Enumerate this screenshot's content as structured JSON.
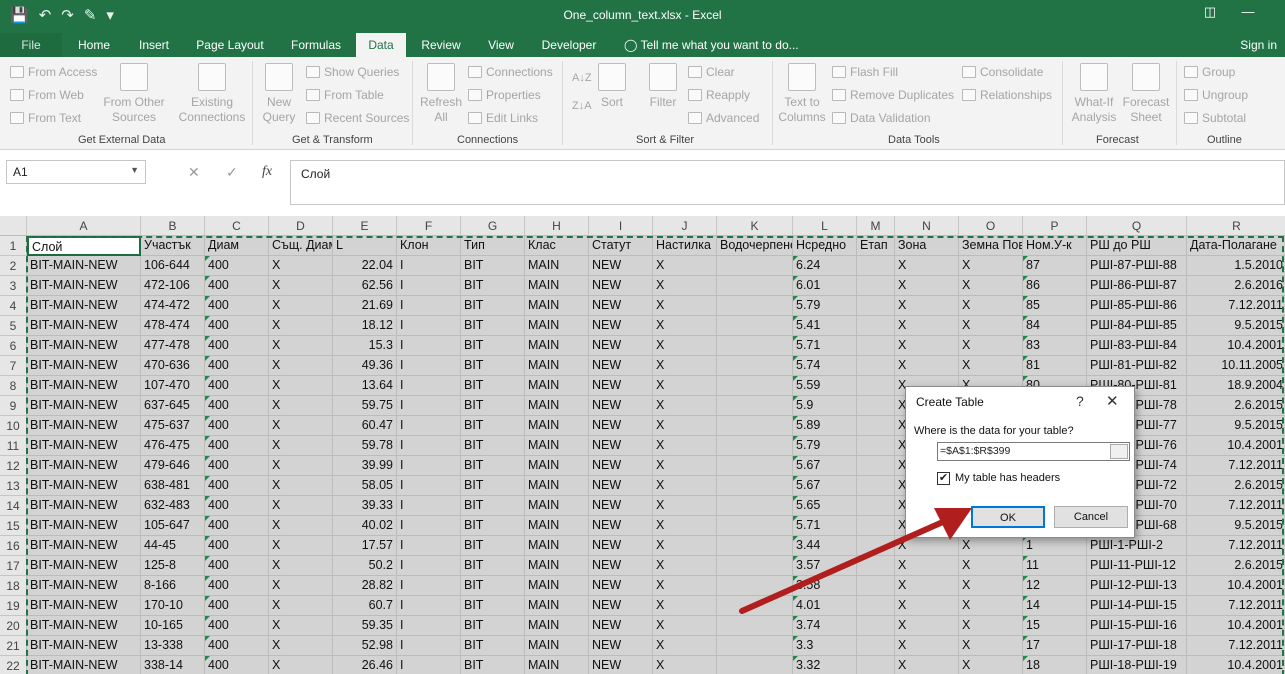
{
  "window": {
    "title": "One_column_text.xlsx - Excel"
  },
  "qat": [
    "save-icon",
    "undo-icon",
    "redo-icon",
    "brush-icon",
    "customize-icon"
  ],
  "tabs": [
    {
      "label": "File"
    },
    {
      "label": "Home"
    },
    {
      "label": "Insert"
    },
    {
      "label": "Page Layout"
    },
    {
      "label": "Formulas"
    },
    {
      "label": "Data"
    },
    {
      "label": "Review"
    },
    {
      "label": "View"
    },
    {
      "label": "Developer"
    }
  ],
  "tell_me": "Tell me what you want to do...",
  "sign_in": "Sign in",
  "ribbon": {
    "get_external": {
      "from_access": "From Access",
      "from_web": "From Web",
      "from_text": "From Text",
      "from_other": "From Other",
      "sources": "Sources",
      "existing": "Existing",
      "connections": "Connections",
      "name": "Get External Data"
    },
    "get_transform": {
      "new": "New",
      "query": "Query",
      "show_queries": "Show Queries",
      "from_table": "From Table",
      "recent_sources": "Recent Sources",
      "name": "Get & Transform"
    },
    "connections": {
      "refresh": "Refresh",
      "all": "All",
      "connections": "Connections",
      "properties": "Properties",
      "edit_links": "Edit Links",
      "name": "Connections"
    },
    "sort_filter": {
      "sort": "Sort",
      "filter": "Filter",
      "clear": "Clear",
      "reapply": "Reapply",
      "advanced": "Advanced",
      "name": "Sort & Filter"
    },
    "data_tools": {
      "text_to": "Text to",
      "columns": "Columns",
      "flash_fill": "Flash Fill",
      "remove_duplicates": "Remove Duplicates",
      "data_validation": "Data Validation",
      "consolidate": "Consolidate",
      "relationships": "Relationships",
      "name": "Data Tools"
    },
    "forecast": {
      "what_if": "What-If",
      "analysis": "Analysis",
      "forecast": "Forecast",
      "sheet": "Sheet",
      "name": "Forecast"
    },
    "outline": {
      "group": "Group",
      "ungroup": "Ungroup",
      "subtotal": "Subtotal",
      "name": "Outline"
    }
  },
  "formula_bar": {
    "name_box": "A1",
    "cancel": "✕",
    "enter": "✓",
    "fx": "fx",
    "content": "Слой"
  },
  "columns": [
    "A",
    "B",
    "C",
    "D",
    "E",
    "F",
    "G",
    "H",
    "I",
    "J",
    "K",
    "L",
    "M",
    "N",
    "O",
    "P",
    "Q",
    "R"
  ],
  "rows": [
    "1",
    "2",
    "3",
    "4",
    "5",
    "6",
    "7",
    "8",
    "9",
    "10",
    "11",
    "12",
    "13",
    "14",
    "15",
    "16",
    "17",
    "18",
    "19",
    "20",
    "21",
    "22"
  ],
  "header_row": [
    "Слой",
    "Участък",
    "Диам",
    "Същ. Диам",
    "L",
    "Клон",
    "Тип",
    "Клас",
    "Статут",
    "Настилка",
    "Водочерпене",
    "Нсредно",
    "Етап",
    "Зона",
    "Земна Пов",
    "Ном.У-к",
    "РШ до РШ",
    "Дата-Полагане"
  ],
  "data_rows": [
    [
      "BIT-MAIN-NEW",
      "106-644",
      "400",
      "X",
      "22.04",
      "I",
      "BIT",
      "MAIN",
      "NEW",
      "X",
      "",
      "6.24",
      "",
      "X",
      "X",
      "87",
      "РШІ-87-РШІ-88",
      "1.5.2010"
    ],
    [
      "BIT-MAIN-NEW",
      "472-106",
      "400",
      "X",
      "62.56",
      "I",
      "BIT",
      "MAIN",
      "NEW",
      "X",
      "",
      "6.01",
      "",
      "X",
      "X",
      "86",
      "РШІ-86-РШІ-87",
      "2.6.2016"
    ],
    [
      "BIT-MAIN-NEW",
      "474-472",
      "400",
      "X",
      "21.69",
      "I",
      "BIT",
      "MAIN",
      "NEW",
      "X",
      "",
      "5.79",
      "",
      "X",
      "X",
      "85",
      "РШІ-85-РШІ-86",
      "7.12.2011"
    ],
    [
      "BIT-MAIN-NEW",
      "478-474",
      "400",
      "X",
      "18.12",
      "I",
      "BIT",
      "MAIN",
      "NEW",
      "X",
      "",
      "5.41",
      "",
      "X",
      "X",
      "84",
      "РШІ-84-РШІ-85",
      "9.5.2015"
    ],
    [
      "BIT-MAIN-NEW",
      "477-478",
      "400",
      "X",
      "15.3",
      "I",
      "BIT",
      "MAIN",
      "NEW",
      "X",
      "",
      "5.71",
      "",
      "X",
      "X",
      "83",
      "РШІ-83-РШІ-84",
      "10.4.2001"
    ],
    [
      "BIT-MAIN-NEW",
      "470-636",
      "400",
      "X",
      "49.36",
      "I",
      "BIT",
      "MAIN",
      "NEW",
      "X",
      "",
      "5.74",
      "",
      "X",
      "X",
      "81",
      "РШІ-81-РШІ-82",
      "10.11.2005"
    ],
    [
      "BIT-MAIN-NEW",
      "107-470",
      "400",
      "X",
      "13.64",
      "I",
      "BIT",
      "MAIN",
      "NEW",
      "X",
      "",
      "5.59",
      "",
      "X",
      "X",
      "80",
      "РШІ-80-РШІ-81",
      "18.9.2004"
    ],
    [
      "BIT-MAIN-NEW",
      "637-645",
      "400",
      "X",
      "59.75",
      "I",
      "BIT",
      "MAIN",
      "NEW",
      "X",
      "",
      "5.9",
      "",
      "X",
      "X",
      "",
      "РШІ-77-РШІ-78",
      "2.6.2015"
    ],
    [
      "BIT-MAIN-NEW",
      "475-637",
      "400",
      "X",
      "60.47",
      "I",
      "BIT",
      "MAIN",
      "NEW",
      "X",
      "",
      "5.89",
      "",
      "X",
      "X",
      "",
      "РШІ-76-РШІ-77",
      "9.5.2015"
    ],
    [
      "BIT-MAIN-NEW",
      "476-475",
      "400",
      "X",
      "59.78",
      "I",
      "BIT",
      "MAIN",
      "NEW",
      "X",
      "",
      "5.79",
      "",
      "X",
      "X",
      "",
      "РШІ-75-РШІ-76",
      "10.4.2001"
    ],
    [
      "BIT-MAIN-NEW",
      "479-646",
      "400",
      "X",
      "39.99",
      "I",
      "BIT",
      "MAIN",
      "NEW",
      "X",
      "",
      "5.67",
      "",
      "X",
      "X",
      "",
      "РШІ-73-РШІ-74",
      "7.12.2011"
    ],
    [
      "BIT-MAIN-NEW",
      "638-481",
      "400",
      "X",
      "58.05",
      "I",
      "BIT",
      "MAIN",
      "NEW",
      "X",
      "",
      "5.67",
      "",
      "X",
      "X",
      "",
      "РШІ-71-РШІ-72",
      "2.6.2015"
    ],
    [
      "BIT-MAIN-NEW",
      "632-483",
      "400",
      "X",
      "39.33",
      "I",
      "BIT",
      "MAIN",
      "NEW",
      "X",
      "",
      "5.65",
      "",
      "X",
      "X",
      "",
      "РШІ-69-РШІ-70",
      "7.12.2011"
    ],
    [
      "BIT-MAIN-NEW",
      "105-647",
      "400",
      "X",
      "40.02",
      "I",
      "BIT",
      "MAIN",
      "NEW",
      "X",
      "",
      "5.71",
      "",
      "X",
      "X",
      "",
      "РШІ-67-РШІ-68",
      "9.5.2015"
    ],
    [
      "BIT-MAIN-NEW",
      "44-45",
      "400",
      "X",
      "17.57",
      "I",
      "BIT",
      "MAIN",
      "NEW",
      "X",
      "",
      "3.44",
      "",
      "X",
      "X",
      "1",
      "РШІ-1-РШІ-2",
      "7.12.2011"
    ],
    [
      "BIT-MAIN-NEW",
      "125-8",
      "400",
      "X",
      "50.2",
      "I",
      "BIT",
      "MAIN",
      "NEW",
      "X",
      "",
      "3.57",
      "",
      "X",
      "X",
      "11",
      "РШІ-11-РШІ-12",
      "2.6.2015"
    ],
    [
      "BIT-MAIN-NEW",
      "8-166",
      "400",
      "X",
      "28.82",
      "I",
      "BIT",
      "MAIN",
      "NEW",
      "X",
      "",
      "3.58",
      "",
      "X",
      "X",
      "12",
      "РШІ-12-РШІ-13",
      "10.4.2001"
    ],
    [
      "BIT-MAIN-NEW",
      "170-10",
      "400",
      "X",
      "60.7",
      "I",
      "BIT",
      "MAIN",
      "NEW",
      "X",
      "",
      "4.01",
      "",
      "X",
      "X",
      "14",
      "РШІ-14-РШІ-15",
      "7.12.2011"
    ],
    [
      "BIT-MAIN-NEW",
      "10-165",
      "400",
      "X",
      "59.35",
      "I",
      "BIT",
      "MAIN",
      "NEW",
      "X",
      "",
      "3.74",
      "",
      "X",
      "X",
      "15",
      "РШІ-15-РШІ-16",
      "10.4.2001"
    ],
    [
      "BIT-MAIN-NEW",
      "13-338",
      "400",
      "X",
      "52.98",
      "I",
      "BIT",
      "MAIN",
      "NEW",
      "X",
      "",
      "3.3",
      "",
      "X",
      "X",
      "17",
      "РШІ-17-РШІ-18",
      "7.12.2011"
    ],
    [
      "BIT-MAIN-NEW",
      "338-14",
      "400",
      "X",
      "26.46",
      "I",
      "BIT",
      "MAIN",
      "NEW",
      "X",
      "",
      "3.32",
      "",
      "X",
      "X",
      "18",
      "РШІ-18-РШІ-19",
      "10.4.2001"
    ]
  ],
  "dialog": {
    "title": "Create Table",
    "help": "?",
    "close": "✕",
    "question": "Where is the data for your table?",
    "range": "=$A$1:$R$399",
    "checkbox_checked": "✔",
    "checkbox_label": "My table has headers",
    "ok": "OK",
    "cancel": "Cancel"
  },
  "colors": {
    "excel_green": "#217346",
    "arrow": "#b01e1e",
    "selection_gray": "#d3d3d3"
  }
}
